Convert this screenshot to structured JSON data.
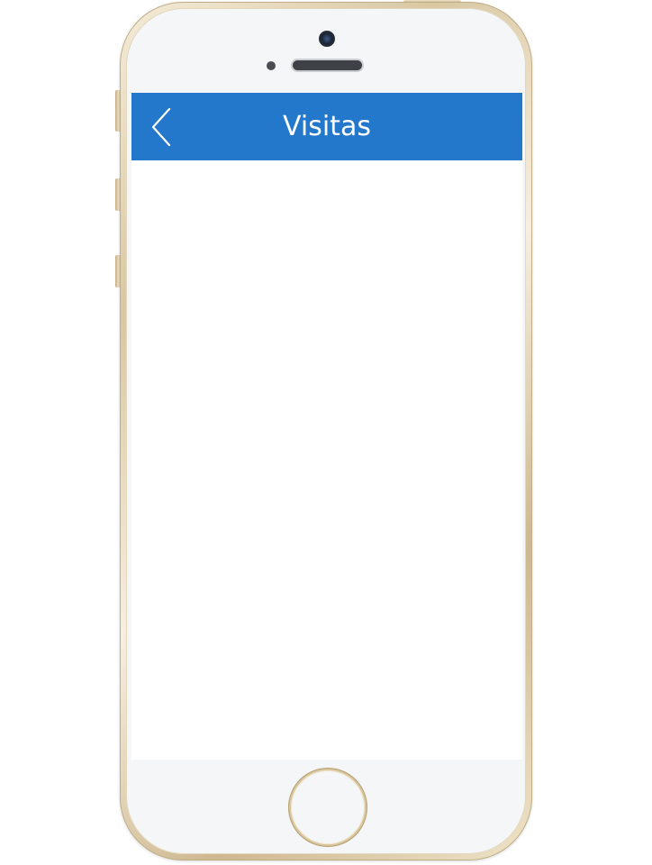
{
  "device": {
    "type": "smartphone",
    "finish_color": "#e6d7b6",
    "screen_background": "#ffffff"
  },
  "nav_bar": {
    "title": "Visitas",
    "background_color": "#2478cc",
    "text_color": "#ffffff",
    "back_icon": "chevron-left-icon"
  },
  "content": {
    "items": []
  }
}
